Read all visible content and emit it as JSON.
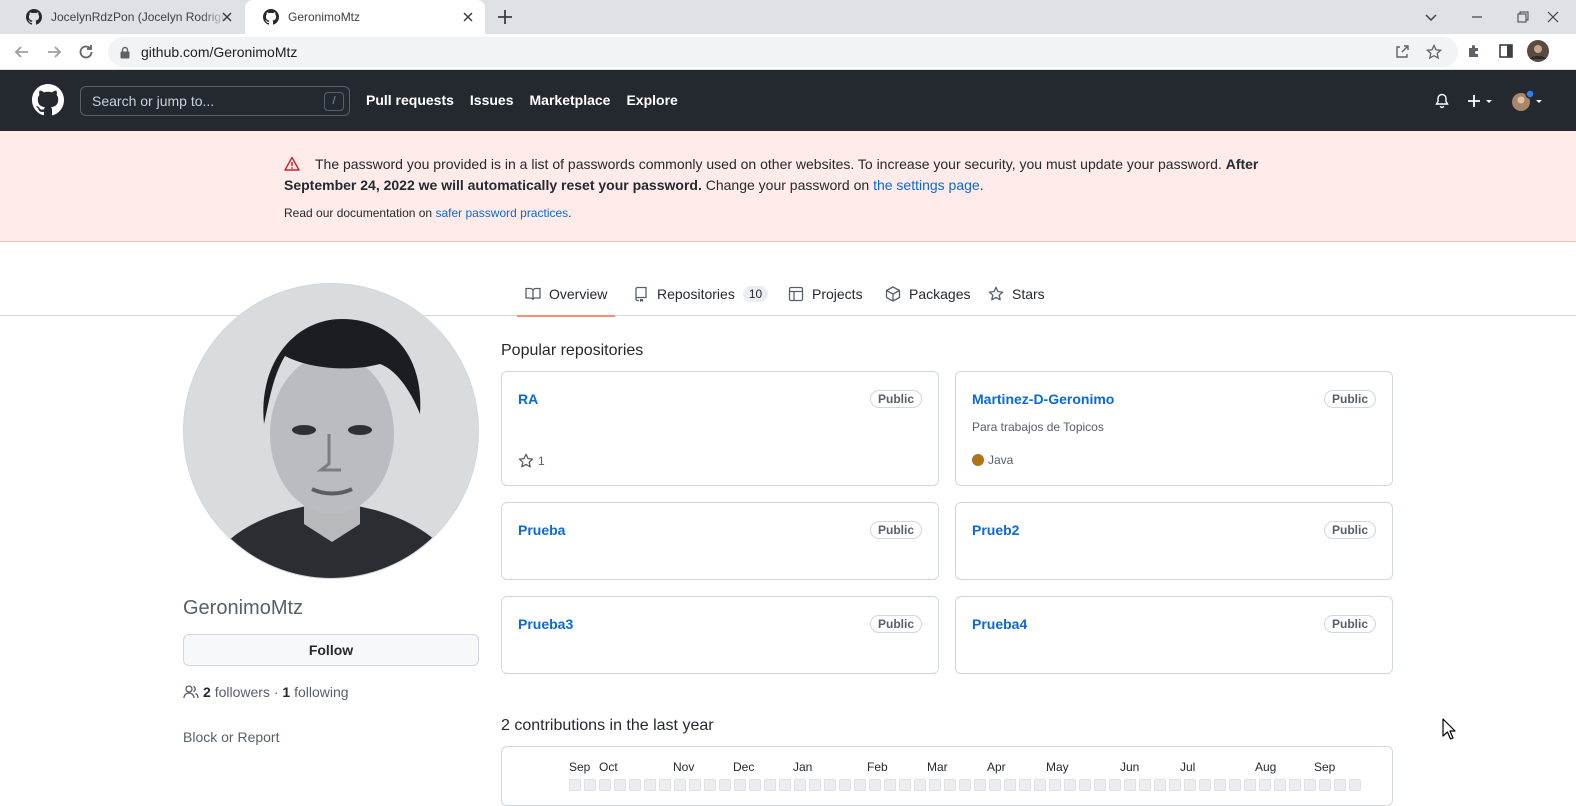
{
  "browser": {
    "tabs": [
      {
        "title": "JocelynRdzPon (Jocelyn Rodriguez Ponce)",
        "active": false
      },
      {
        "title": "GeronimoMtz",
        "active": true
      }
    ],
    "url_host": "github.com",
    "url_path": "/GeronimoMtz"
  },
  "header": {
    "search_placeholder": "Search or jump to...",
    "search_shortcut": "/",
    "nav": [
      "Pull requests",
      "Issues",
      "Marketplace",
      "Explore"
    ]
  },
  "banner": {
    "text_normal": "The password you provided is in a list of passwords commonly used on other websites. To increase your security, you must update your password. ",
    "text_bold": "After September 24, 2022 we will automatically reset your password.",
    "text_after": " Change your password on ",
    "settings_link": "the settings page",
    "period": ".",
    "doc_prefix": "Read our documentation on ",
    "doc_link": "safer password practices",
    "doc_suffix": "."
  },
  "tabs": {
    "overview": "Overview",
    "repositories": "Repositories",
    "repo_count": "10",
    "projects": "Projects",
    "packages": "Packages",
    "stars": "Stars"
  },
  "profile": {
    "username": "GeronimoMtz",
    "follow_label": "Follow",
    "followers_count": "2",
    "followers_label": "followers",
    "separator": " · ",
    "following_count": "1",
    "following_label": "following",
    "block_report": "Block or Report"
  },
  "popular": {
    "title": "Popular repositories",
    "repos": [
      {
        "name": "RA",
        "visibility": "Public",
        "stars": "1"
      },
      {
        "name": "Martinez-D-Geronimo",
        "visibility": "Public",
        "description": "Para trabajos de Topicos",
        "language": "Java",
        "language_color": "#b07219"
      },
      {
        "name": "Prueba",
        "visibility": "Public"
      },
      {
        "name": "Prueb2",
        "visibility": "Public"
      },
      {
        "name": "Prueba3",
        "visibility": "Public"
      },
      {
        "name": "Prueba4",
        "visibility": "Public"
      }
    ]
  },
  "contributions": {
    "title": "2 contributions in the last year",
    "months": [
      "Sep",
      "Oct",
      "Nov",
      "Dec",
      "Jan",
      "Feb",
      "Mar",
      "Apr",
      "May",
      "Jun",
      "Jul",
      "Aug",
      "Sep"
    ]
  },
  "colors": {
    "header_bg": "#24292f",
    "banner_bg": "#ffebe9",
    "link": "#0969da",
    "tab_underline": "#fd8c73"
  }
}
